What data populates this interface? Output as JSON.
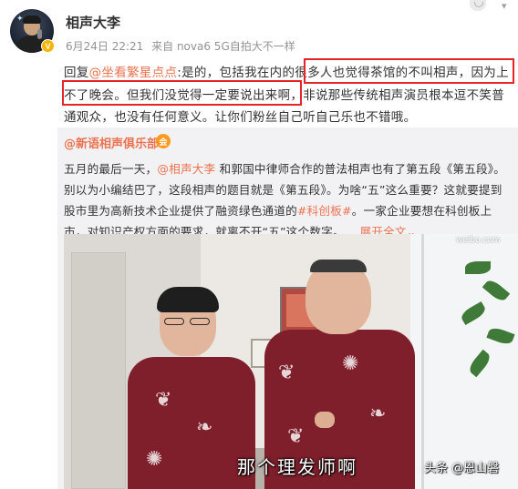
{
  "post": {
    "username": "相声大李",
    "verified_badge": "V",
    "date": "6月24日 22:21",
    "source": "来自 nova6 5G自拍大不一样",
    "reply_prefix": "回复",
    "reply_mention": "@坐看繁星点点",
    "reply_body": ":是的，包括我在内的很多人也觉得茶馆的不叫相声，因为上不了晚会。但我们没觉得一定要说出来啊，非说那些传统相声演员根本逗不笑普通观众，也没有任何意义。让你们粉丝自己听自己乐也不错哦。"
  },
  "repost": {
    "author": "@新语相声俱乐部",
    "author_badge": "会",
    "text_1": "五月的最后一天，",
    "mention": "@相声大李",
    "text_2": " 和郭国中律师合作的普法相声也有了第五段《第五段》。别以为小编结巴了，这段相声的题目就是《第五段》。为啥“五”这么重要？这就要提到股市里为高新技术企业提供了融资绿色通道的",
    "hashtag": "#科创板#",
    "text_3": "。一家企业要想在科创板上市，对知识产权方面的要求，就离不开“五”这个数字。...",
    "expand_label": "展开全文",
    "expand_icon": "chevron-down"
  },
  "video": {
    "subtitle": "那个理发师啊",
    "watermark": "头条 @恩山磐",
    "corner_logo": "weibo.com"
  },
  "colors": {
    "link": "#eb7350",
    "highlight_box": "#e5242b",
    "repost_bg": "#f2f2f5",
    "meta_gray": "#939393"
  }
}
